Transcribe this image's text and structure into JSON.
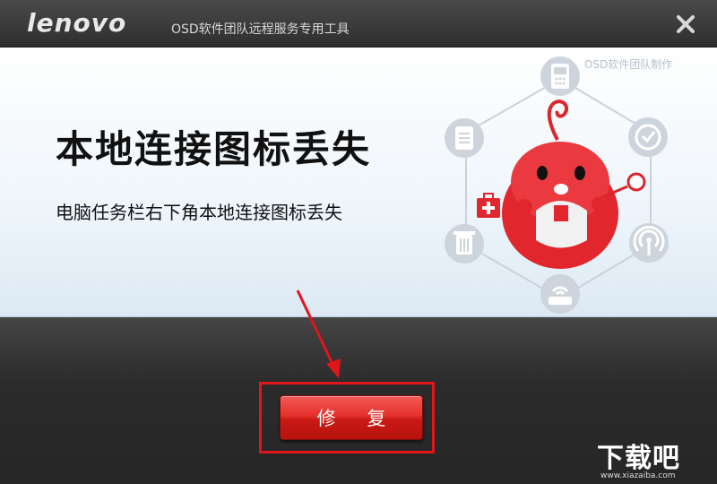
{
  "titlebar": {
    "logo": "lenovo",
    "title": "OSD软件团队远程服务专用工具",
    "close_icon": "close-icon"
  },
  "banner": {
    "team_label": "OSD软件团队制作",
    "headline": "本地连接图标丢失",
    "description": "电脑任务栏右下角本地连接图标丢失",
    "icons": [
      "phone-icon",
      "clock-icon",
      "wifi-icon",
      "router-icon",
      "trash-icon",
      "document-icon",
      "first-aid-icon",
      "mascot-icon"
    ]
  },
  "action": {
    "repair_label": "修 复"
  },
  "watermark": {
    "brand": "下载吧",
    "url": "www.xiazaiba.com"
  },
  "colors": {
    "accent_red": "#e0161b",
    "button_red": "#e5312c",
    "titlebar": "#3a3a3a",
    "banner_bg": "#eef5fb"
  }
}
